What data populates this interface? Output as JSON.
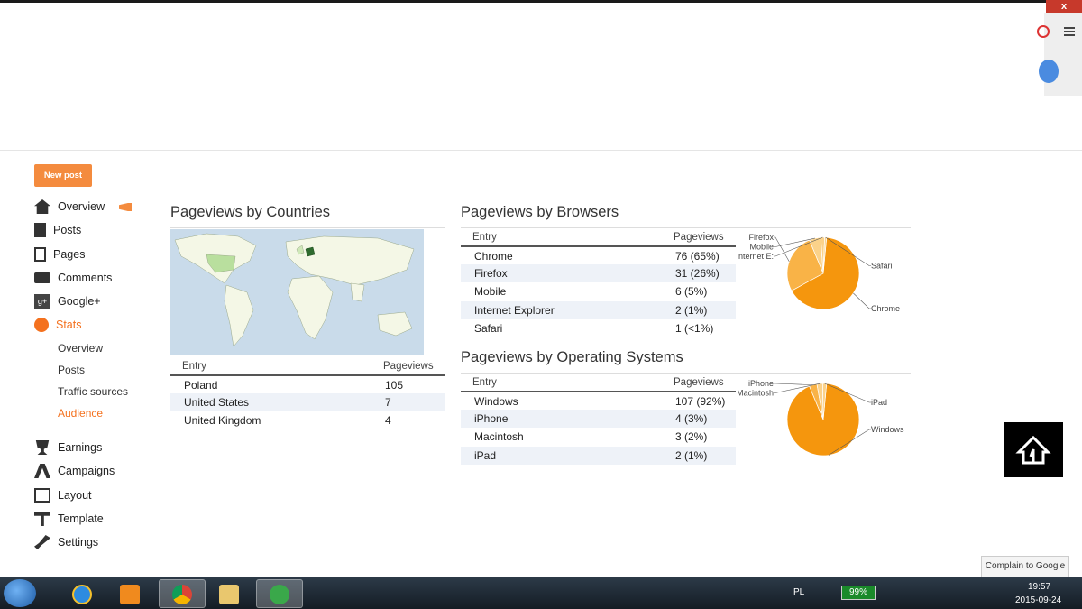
{
  "window": {
    "close_glyph": "x"
  },
  "sidebar": {
    "new_post": "New post",
    "items": [
      {
        "label": "Overview",
        "icon": "home-icon"
      },
      {
        "label": "Posts",
        "icon": "posts-icon"
      },
      {
        "label": "Pages",
        "icon": "pages-icon"
      },
      {
        "label": "Comments",
        "icon": "comments-icon"
      },
      {
        "label": "Google+",
        "icon": "google-plus-icon"
      },
      {
        "label": "Stats",
        "icon": "pie-chart-icon"
      }
    ],
    "stats_sub": [
      "Overview",
      "Posts",
      "Traffic sources",
      "Audience"
    ],
    "items2": [
      {
        "label": "Earnings",
        "icon": "trophy-icon"
      },
      {
        "label": "Campaigns",
        "icon": "campaigns-icon"
      },
      {
        "label": "Layout",
        "icon": "layout-icon"
      },
      {
        "label": "Template",
        "icon": "template-icon"
      },
      {
        "label": "Settings",
        "icon": "wrench-icon"
      }
    ]
  },
  "countries": {
    "title": "Pageviews by Countries",
    "col_entry": "Entry",
    "col_views": "Pageviews",
    "rows": [
      {
        "entry": "Poland",
        "views": "105"
      },
      {
        "entry": "United States",
        "views": "7"
      },
      {
        "entry": "United Kingdom",
        "views": "4"
      }
    ]
  },
  "browsers": {
    "title": "Pageviews by Browsers",
    "col_entry": "Entry",
    "col_views": "Pageviews",
    "rows": [
      {
        "entry": "Chrome",
        "views": "76 (65%)"
      },
      {
        "entry": "Firefox",
        "views": "31 (26%)"
      },
      {
        "entry": "Mobile",
        "views": "6 (5%)"
      },
      {
        "entry": "Internet Explorer",
        "views": "2 (1%)"
      },
      {
        "entry": "Safari",
        "views": "1 (<1%)"
      }
    ],
    "pie_labels": [
      "Chrome",
      "Firefox",
      "Mobile",
      "Internet E:",
      "Safari"
    ]
  },
  "os": {
    "title": "Pageviews by Operating Systems",
    "col_entry": "Entry",
    "col_views": "Pageviews",
    "rows": [
      {
        "entry": "Windows",
        "views": "107 (92%)"
      },
      {
        "entry": "iPhone",
        "views": "4 (3%)"
      },
      {
        "entry": "Macintosh",
        "views": "3 (2%)"
      },
      {
        "entry": "iPad",
        "views": "2 (1%)"
      }
    ],
    "pie_labels": [
      "Windows",
      "iPhone",
      "Macintosh",
      "iPad"
    ]
  },
  "chart_data": [
    {
      "type": "pie",
      "categories": [
        "Chrome",
        "Firefox",
        "Mobile",
        "Internet Explorer",
        "Safari"
      ],
      "values": [
        76,
        31,
        6,
        2,
        1
      ]
    },
    {
      "type": "pie",
      "categories": [
        "Windows",
        "iPhone",
        "Macintosh",
        "iPad"
      ],
      "values": [
        107,
        4,
        3,
        2
      ]
    }
  ],
  "colors": {
    "accent": "#f48b3e",
    "pie_main": "#f5960d",
    "pie_slice": "#f9b347"
  },
  "footer": {
    "complain": "Complain to Google"
  },
  "taskbar": {
    "lang": "PL",
    "battery": "99%",
    "time": "19:57",
    "date": "2015-09-24"
  }
}
